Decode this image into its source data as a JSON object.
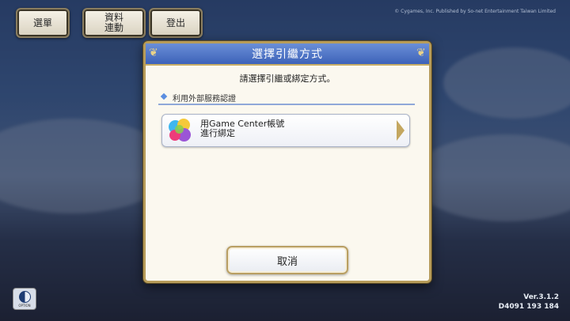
{
  "top_buttons": [
    {
      "label": "選單"
    },
    {
      "label": "資料\n連動"
    },
    {
      "label": "登出"
    }
  ],
  "copyright": "© Cygames, Inc. Published by So-net Entertainment Taiwan Limited",
  "dialog": {
    "title": "選擇引繼方式",
    "prompt": "請選擇引繼或綁定方式。",
    "section_label": "利用外部服務認證",
    "option": {
      "line1": "用Game Center帳號",
      "line2": "進行綁定",
      "icon": "game-center-icon"
    },
    "cancel_label": "取消"
  },
  "version": {
    "line1": "Ver.3.1.2",
    "line2": "D4091 193 184"
  },
  "colors": {
    "title_bar": "#4a70c4",
    "frame": "#b79c5a",
    "accent": "#5b8ee0"
  }
}
